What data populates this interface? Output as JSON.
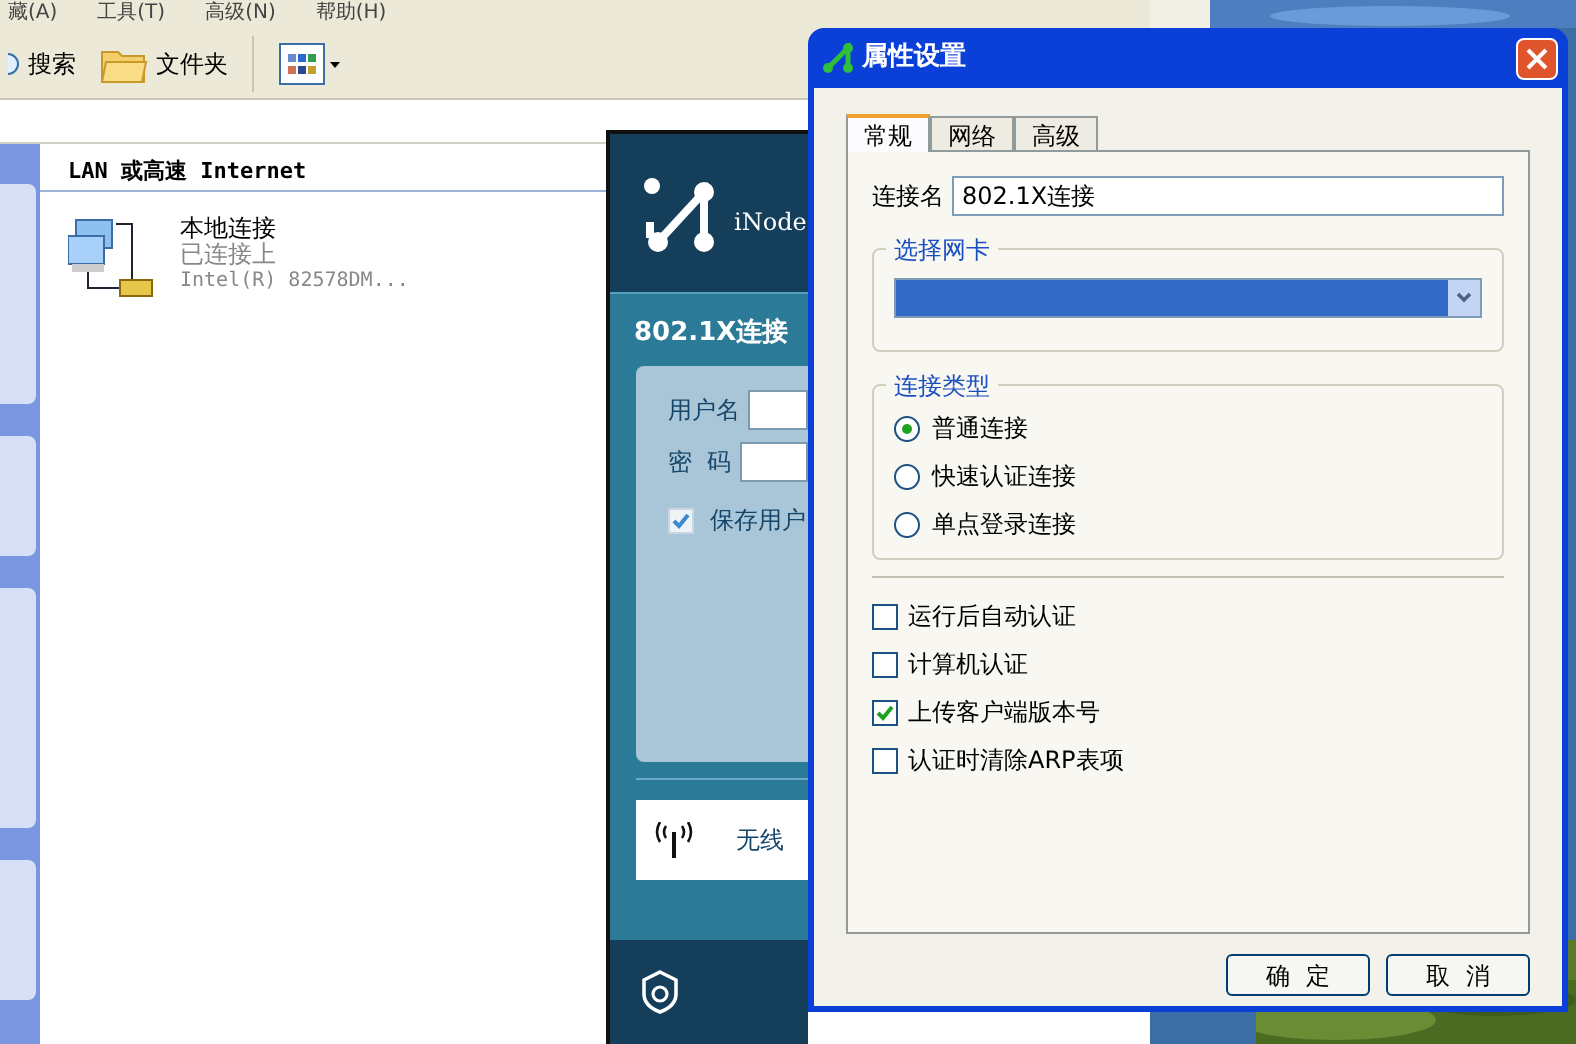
{
  "explorer": {
    "menu": [
      "藏(A)",
      "工具(T)",
      "高级(N)",
      "帮助(H)"
    ],
    "toolbar": [
      "搜索",
      "文件夹"
    ],
    "group_header": "LAN 或高速 Internet",
    "connection": {
      "name": "本地连接",
      "status": "已连接上",
      "device": "Intel(R) 82578DM..."
    }
  },
  "inode": {
    "app_name": "iNode",
    "title": "802.1X连接",
    "username_label": "用户名",
    "password_label": "密  码",
    "save_user": {
      "label": "保存用户",
      "checked": true
    },
    "wireless": "无线"
  },
  "dialog": {
    "title": "属性设置",
    "tabs": [
      {
        "label": "常规",
        "selected": true
      },
      {
        "label": "网络",
        "selected": false
      },
      {
        "label": "高级",
        "selected": false
      }
    ],
    "connection_name_label": "连接名",
    "connection_name": "802.1X连接",
    "nic_group": "选择网卡",
    "type_group": "连接类型",
    "types": [
      {
        "label": "普通连接",
        "selected": true
      },
      {
        "label": "快速认证连接",
        "selected": false
      },
      {
        "label": "单点登录连接",
        "selected": false
      }
    ],
    "options": [
      {
        "label": "运行后自动认证",
        "checked": false
      },
      {
        "label": "计算机认证",
        "checked": false
      },
      {
        "label": "上传客户端版本号",
        "checked": true
      },
      {
        "label": "认证时清除ARP表项",
        "checked": false
      }
    ],
    "buttons": [
      "确  定",
      "取  消"
    ]
  }
}
